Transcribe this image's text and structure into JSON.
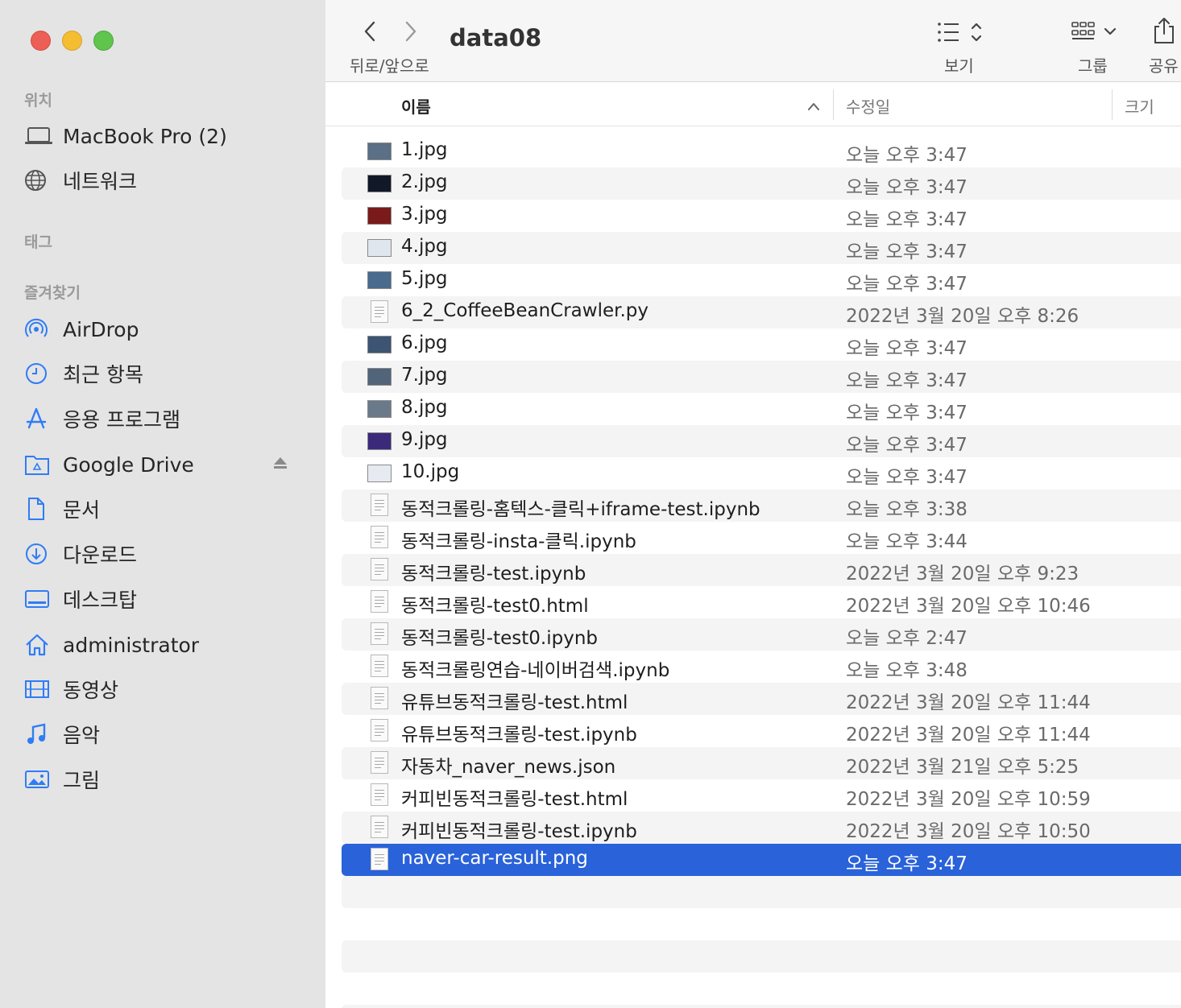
{
  "window": {
    "title": "data08"
  },
  "toolbar": {
    "nav_label": "뒤로/앞으로",
    "view_label": "보기",
    "group_label": "그룹",
    "share_label": "공유"
  },
  "sidebar": {
    "section_locations": "위치",
    "section_tags": "태그",
    "section_favorites": "즐겨찾기",
    "locations": [
      {
        "label": "MacBook Pro (2)",
        "icon": "laptop-icon"
      },
      {
        "label": "네트워크",
        "icon": "globe-icon"
      }
    ],
    "favorites": [
      {
        "label": "AirDrop",
        "icon": "airdrop-icon"
      },
      {
        "label": "최근 항목",
        "icon": "clock-icon"
      },
      {
        "label": "응용 프로그램",
        "icon": "apps-icon"
      },
      {
        "label": "Google Drive",
        "icon": "cloud-folder-icon"
      },
      {
        "label": "문서",
        "icon": "document-icon"
      },
      {
        "label": "다운로드",
        "icon": "download-icon"
      },
      {
        "label": "데스크탑",
        "icon": "desktop-icon"
      },
      {
        "label": "administrator",
        "icon": "home-icon"
      },
      {
        "label": "동영상",
        "icon": "film-icon"
      },
      {
        "label": "음악",
        "icon": "music-icon"
      },
      {
        "label": "그림",
        "icon": "photo-icon"
      }
    ]
  },
  "columns": {
    "name": "이름",
    "date": "수정일",
    "size": "크기"
  },
  "files": [
    {
      "name": "1.jpg",
      "date": "오늘 오후 3:47",
      "kind": "image",
      "thumb": "#5b6f86"
    },
    {
      "name": "2.jpg",
      "date": "오늘 오후 3:47",
      "kind": "image",
      "thumb": "#111827"
    },
    {
      "name": "3.jpg",
      "date": "오늘 오후 3:47",
      "kind": "image",
      "thumb": "#7a1a1a"
    },
    {
      "name": "4.jpg",
      "date": "오늘 오후 3:47",
      "kind": "image",
      "thumb": "#dfe6ee"
    },
    {
      "name": "5.jpg",
      "date": "오늘 오후 3:47",
      "kind": "image",
      "thumb": "#4a6a8e"
    },
    {
      "name": "6_2_CoffeeBeanCrawler.py",
      "date": "2022년 3월 20일 오후 8:26",
      "kind": "doc"
    },
    {
      "name": "6.jpg",
      "date": "오늘 오후 3:47",
      "kind": "image",
      "thumb": "#3d5473"
    },
    {
      "name": "7.jpg",
      "date": "오늘 오후 3:47",
      "kind": "image",
      "thumb": "#51647a"
    },
    {
      "name": "8.jpg",
      "date": "오늘 오후 3:47",
      "kind": "image",
      "thumb": "#6b7a8a"
    },
    {
      "name": "9.jpg",
      "date": "오늘 오후 3:47",
      "kind": "image",
      "thumb": "#3b2a7a"
    },
    {
      "name": "10.jpg",
      "date": "오늘 오후 3:47",
      "kind": "image",
      "thumb": "#e6ebf1"
    },
    {
      "name": "동적크롤링-홈텍스-클릭+iframe-test.ipynb",
      "date": "오늘 오후 3:38",
      "kind": "doc"
    },
    {
      "name": "동적크롤링-insta-클릭.ipynb",
      "date": "오늘 오후 3:44",
      "kind": "doc"
    },
    {
      "name": "동적크롤링-test.ipynb",
      "date": "2022년 3월 20일 오후 9:23",
      "kind": "doc"
    },
    {
      "name": "동적크롤링-test0.html",
      "date": "2022년 3월 20일 오후 10:46",
      "kind": "doc"
    },
    {
      "name": "동적크롤링-test0.ipynb",
      "date": "오늘 오후 2:47",
      "kind": "doc"
    },
    {
      "name": "동적크롤링연습-네이버검색.ipynb",
      "date": "오늘 오후 3:48",
      "kind": "doc"
    },
    {
      "name": "유튜브동적크롤링-test.html",
      "date": "2022년 3월 20일 오후 11:44",
      "kind": "doc"
    },
    {
      "name": "유튜브동적크롤링-test.ipynb",
      "date": "2022년 3월 20일 오후 11:44",
      "kind": "doc"
    },
    {
      "name": "자동차_naver_news.json",
      "date": "2022년 3월 21일 오후 5:25",
      "kind": "doc"
    },
    {
      "name": "커피빈동적크롤링-test.html",
      "date": "2022년 3월 20일 오후 10:59",
      "kind": "doc"
    },
    {
      "name": "커피빈동적크롤링-test.ipynb",
      "date": "2022년 3월 20일 오후 10:50",
      "kind": "doc"
    },
    {
      "name": "naver-car-result.png",
      "date": "오늘 오후 3:47",
      "kind": "doc",
      "selected": true
    }
  ],
  "colors": {
    "selection": "#2962d9",
    "sidebar_bg": "#e4e4e4",
    "accent_icon": "#2f7cf6"
  }
}
